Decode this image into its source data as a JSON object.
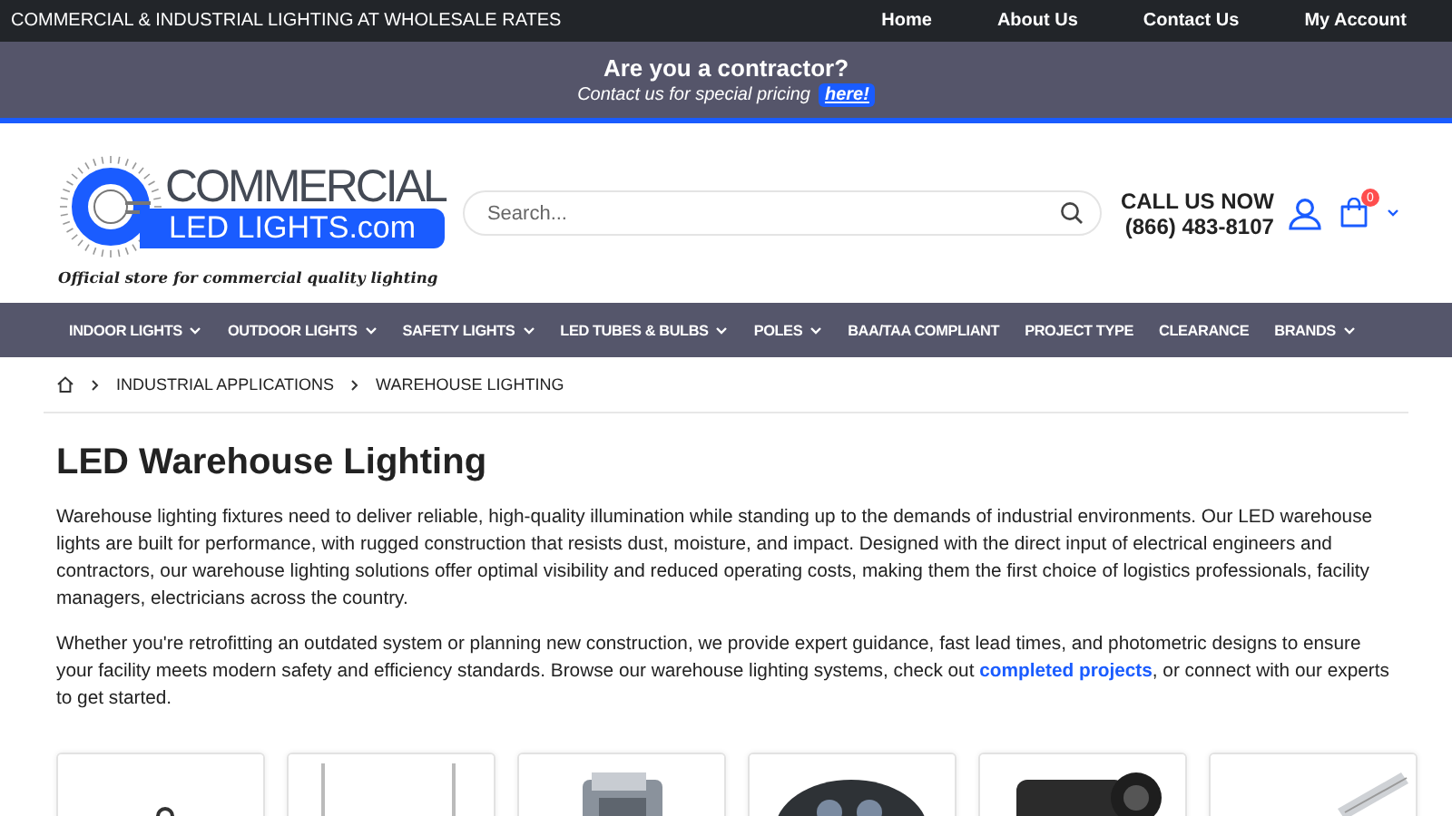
{
  "top_bar": {
    "tagline": "COMMERCIAL & INDUSTRIAL LIGHTING AT WHOLESALE RATES",
    "links": [
      "Home",
      "About Us",
      "Contact Us",
      "My Account"
    ]
  },
  "promo": {
    "heading": "Are you a contractor?",
    "text": "Contact us for special pricing",
    "link": "here!"
  },
  "header": {
    "logo": {
      "line_1": "COMMERCIAL",
      "line_2": "LED LIGHTS.com",
      "tagline": "Official store for commercial quality lighting"
    },
    "search": {
      "placeholder": "Search..."
    },
    "call": {
      "label": "CALL US NOW",
      "phone": "(866) 483-8107"
    },
    "cart_count": "0"
  },
  "nav": [
    {
      "label": "INDOOR LIGHTS",
      "dropdown": true
    },
    {
      "label": "OUTDOOR LIGHTS",
      "dropdown": true
    },
    {
      "label": "SAFETY LIGHTS",
      "dropdown": true
    },
    {
      "label": "LED TUBES & BULBS",
      "dropdown": true
    },
    {
      "label": "POLES",
      "dropdown": true
    },
    {
      "label": "BAA/TAA COMPLIANT",
      "dropdown": false
    },
    {
      "label": "PROJECT TYPE",
      "dropdown": false
    },
    {
      "label": "CLEARANCE",
      "dropdown": false
    },
    {
      "label": "BRANDS",
      "dropdown": true
    }
  ],
  "breadcrumb": [
    "INDUSTRIAL APPLICATIONS",
    "WAREHOUSE LIGHTING"
  ],
  "content": {
    "title": "LED Warehouse Lighting",
    "paragraphs": [
      {
        "text": "Warehouse lighting fixtures need to deliver reliable, high-quality illumination while standing up to the demands of industrial environments. Our LED warehouse lights are built for performance, with rugged construction that resists dust, moisture, and impact. Designed with the direct input of electrical engineers and contractors, our warehouse lighting solutions offer optimal visibility and reduced operating costs, making them the first choice of logistics professionals, facility managers, electricians across the country."
      },
      {
        "text": "Whether you're retrofitting an outdated system or planning new construction, we provide expert guidance, fast lead times, and photometric designs to ensure your facility meets modern safety and efficiency standards. Browse our warehouse lighting systems, check out ",
        "link": "completed projects",
        "after": ", or connect with our experts to get started."
      }
    ]
  }
}
